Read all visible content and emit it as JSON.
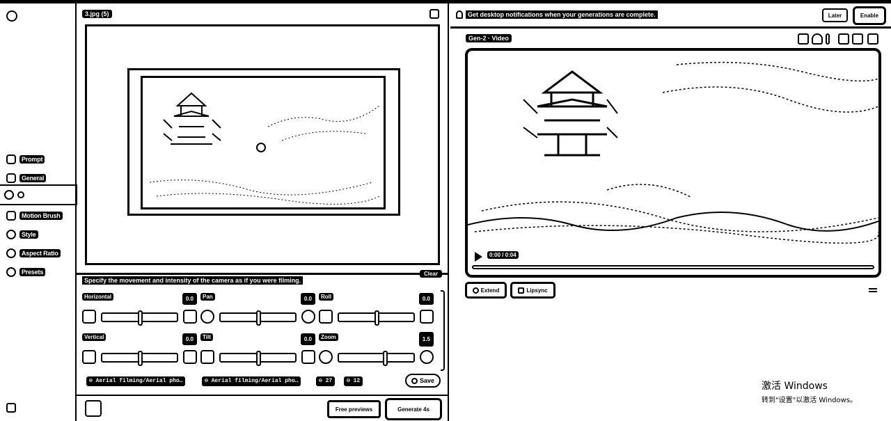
{
  "rail": {
    "items": [
      {
        "label": "Prompt",
        "icon": "text-icon"
      },
      {
        "label": "General",
        "icon": "sliders-icon"
      },
      {
        "label": "",
        "icon": "camera-icon"
      },
      {
        "label": "Motion Brush",
        "icon": "brush-icon"
      },
      {
        "label": "Style",
        "icon": "palette-icon"
      },
      {
        "label": "Aspect Ratio",
        "icon": "aspect-icon"
      },
      {
        "label": "Presets",
        "icon": "layers-icon"
      }
    ]
  },
  "source": {
    "filename": "3.jpg (5)"
  },
  "camera": {
    "description": "Specify the movement and intensity of the camera as if you were filming.",
    "clear_label": "Clear",
    "controls": [
      {
        "name": "Horizontal",
        "value": "0.0"
      },
      {
        "name": "Pan",
        "value": "0.0"
      },
      {
        "name": "Roll",
        "value": "0.0"
      },
      {
        "name": "Vertical",
        "value": "0.0"
      },
      {
        "name": "Tilt",
        "value": "0.0"
      },
      {
        "name": "Zoom",
        "value": "1.5"
      }
    ],
    "preset_chip_1": "Aerial filming/Aerial pho…",
    "preset_chip_2": "Aerial filming/Aerial pho…",
    "count_chip_1": "27",
    "count_chip_2": "12",
    "save_label": "Save"
  },
  "footer": {
    "free_previews_label": "Free previews",
    "generate_label": "Generate 4s"
  },
  "notification": {
    "message": "Get desktop notifications when your generations are complete.",
    "later_label": "Later",
    "enable_label": "Enable"
  },
  "output": {
    "title": "Gen-2 · Video",
    "time": "0:00 / 0:04",
    "progress": 0.0,
    "extend_label": "Extend",
    "lipsync_label": "Lipsync"
  },
  "watermark": {
    "line1": "激活 Windows",
    "line2": "转到\"设置\"以激活 Windows。"
  }
}
